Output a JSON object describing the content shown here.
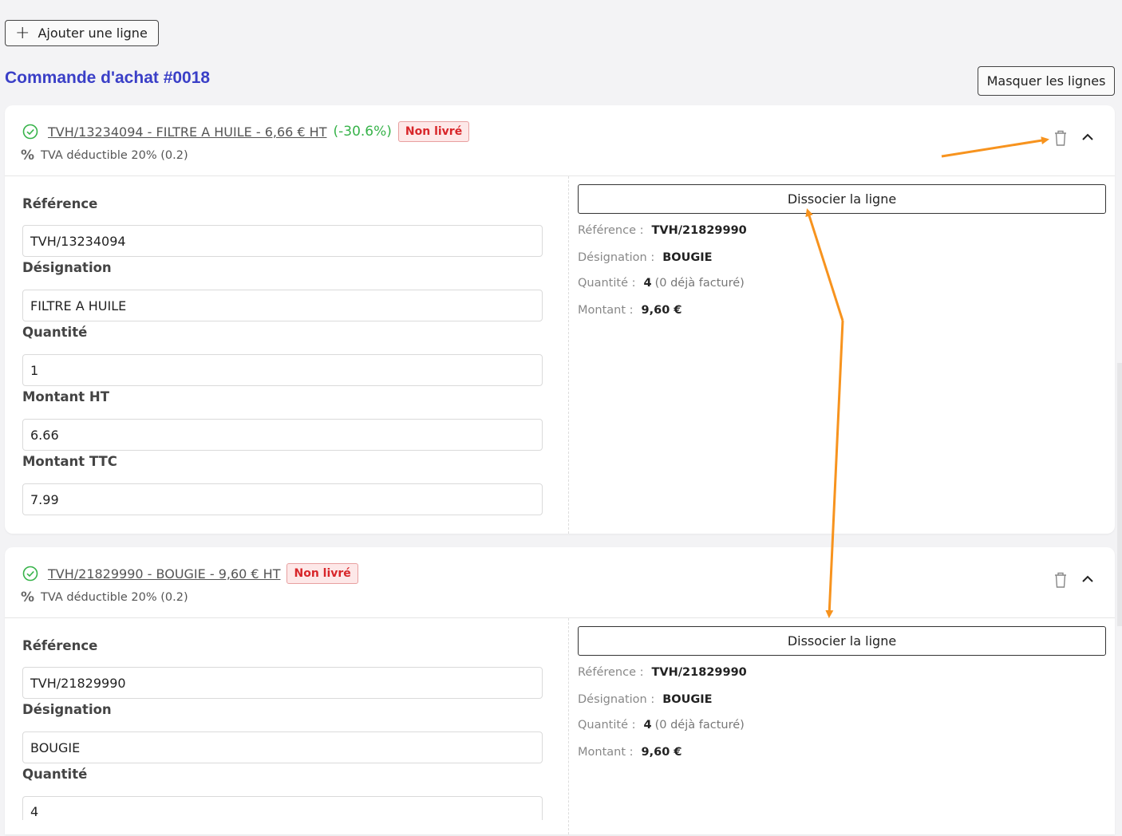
{
  "toolbar": {
    "add_line_label": "Ajouter une ligne",
    "hide_lines_label": "Masquer les lignes"
  },
  "purchase_order": {
    "title": "Commande d'achat #0018"
  },
  "lines": [
    {
      "link_text": "TVH/13234094 - FILTRE A HUILE - 6,66 € HT",
      "discount": "(-30.6%)",
      "status": "Non livré",
      "vat": "TVA déductible 20% (0.2)",
      "labels": {
        "reference": "Référence",
        "designation": "Désignation",
        "quantity": "Quantité",
        "amount_ht": "Montant HT",
        "amount_ttc": "Montant TTC"
      },
      "values": {
        "reference": "TVH/13234094",
        "designation": "FILTRE A HUILE",
        "quantity": "1",
        "amount_ht": "6.66",
        "amount_ttc": "7.99"
      },
      "linked": {
        "dissociate_label": "Dissocier la ligne",
        "reference_label": "Référence :",
        "reference": "TVH/21829990",
        "designation_label": "Désignation :",
        "designation": "BOUGIE",
        "quantity_label": "Quantité :",
        "quantity": "4",
        "quantity_note": "(0 déjà facturé)",
        "amount_label": "Montant :",
        "amount": "9,60 €"
      }
    },
    {
      "link_text": "TVH/21829990 - BOUGIE - 9,60 € HT",
      "status": "Non livré",
      "vat": "TVA déductible 20% (0.2)",
      "labels": {
        "reference": "Référence",
        "designation": "Désignation",
        "quantity": "Quantité"
      },
      "values": {
        "reference": "TVH/21829990",
        "designation": "BOUGIE",
        "quantity": "4"
      },
      "linked": {
        "dissociate_label": "Dissocier la ligne",
        "reference_label": "Référence :",
        "reference": "TVH/21829990",
        "designation_label": "Désignation :",
        "designation": "BOUGIE",
        "quantity_label": "Quantité :",
        "quantity": "4",
        "quantity_note": "(0 déjà facturé)",
        "amount_label": "Montant :",
        "amount": "9,60 €"
      }
    }
  ],
  "colors": {
    "accent": "#3a3fc7",
    "success": "#37b34a",
    "danger": "#d8262a",
    "annotation": "#f7931e"
  },
  "icons": [
    "plus-icon",
    "check-circle-icon",
    "percent-icon",
    "trash-icon",
    "chevron-up-icon"
  ]
}
